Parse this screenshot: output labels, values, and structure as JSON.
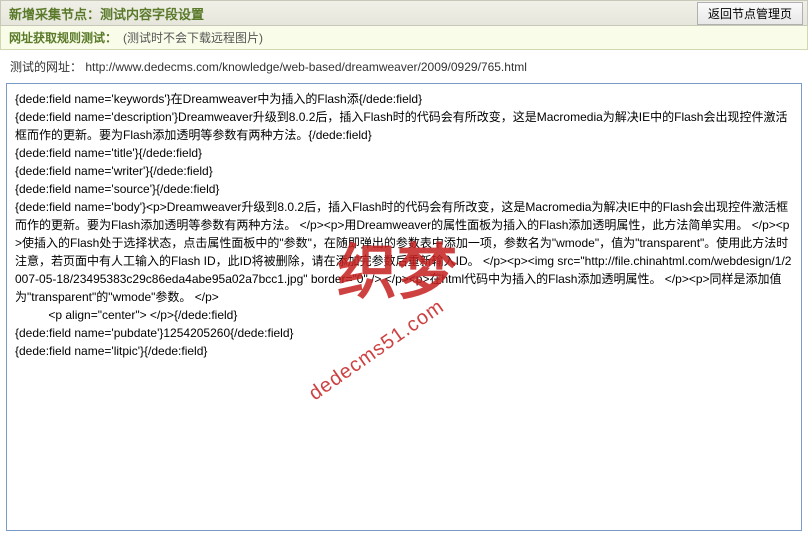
{
  "header": {
    "title": "新增采集节点：测试内容字段设置",
    "back_button": "返回节点管理页"
  },
  "subbar": {
    "title": "网址获取规则测试：",
    "note": "(测试时不会下载远程图片)"
  },
  "url_row": {
    "label": "测试的网址：",
    "value": "http://www.dedecms.com/knowledge/web-based/dreamweaver/2009/0929/765.html"
  },
  "textarea": {
    "content": "{dede:field name='keywords'}在Dreamweaver中为插入的Flash添{/dede:field}\n{dede:field name='description'}Dreamweaver升级到8.0.2后，插入Flash时的代码会有所改变，这是Macromedia为解决IE中的Flash会出现控件激活框而作的更新。要为Flash添加透明等参数有两种方法。{/dede:field}\n{dede:field name='title'}{/dede:field}\n{dede:field name='writer'}{/dede:field}\n{dede:field name='source'}{/dede:field}\n{dede:field name='body'}<p>Dreamweaver升级到8.0.2后，插入Flash时的代码会有所改变，这是Macromedia为解决IE中的Flash会出现控件激活框而作的更新。要为Flash添加透明等参数有两种方法。 </p><p>用Dreamweaver的属性面板为插入的Flash添加透明属性，此方法简单实用。 </p><p>使插入的Flash处于选择状态，点击属性面板中的\"参数\"，在随即弹出的参数表中添加一项，参数名为\"wmode\"，值为\"transparent\"。使用此方法时注意，若页面中有人工输入的Flash ID，此ID将被删除，请在添加完参数后重新输入ID。 </p><p><img src=\"http://file.chinahtml.com/webdesign/1/2007-05-18/23495383c29c86eda4abe95a02a7bcc1.jpg\" border=\"0\" /> </p><p>在html代码中为插入的Flash添加透明属性。 </p><p>同样是添加值为\"transparent\"的\"wmode\"参数。 </p>\n          <p align=\"center\"> </p>{/dede:field}\n{dede:field name='pubdate'}1254205260{/dede:field}\n{dede:field name='litpic'}{/dede:field}"
  },
  "watermark": {
    "text": "织梦",
    "url": "dedecms51.com"
  }
}
